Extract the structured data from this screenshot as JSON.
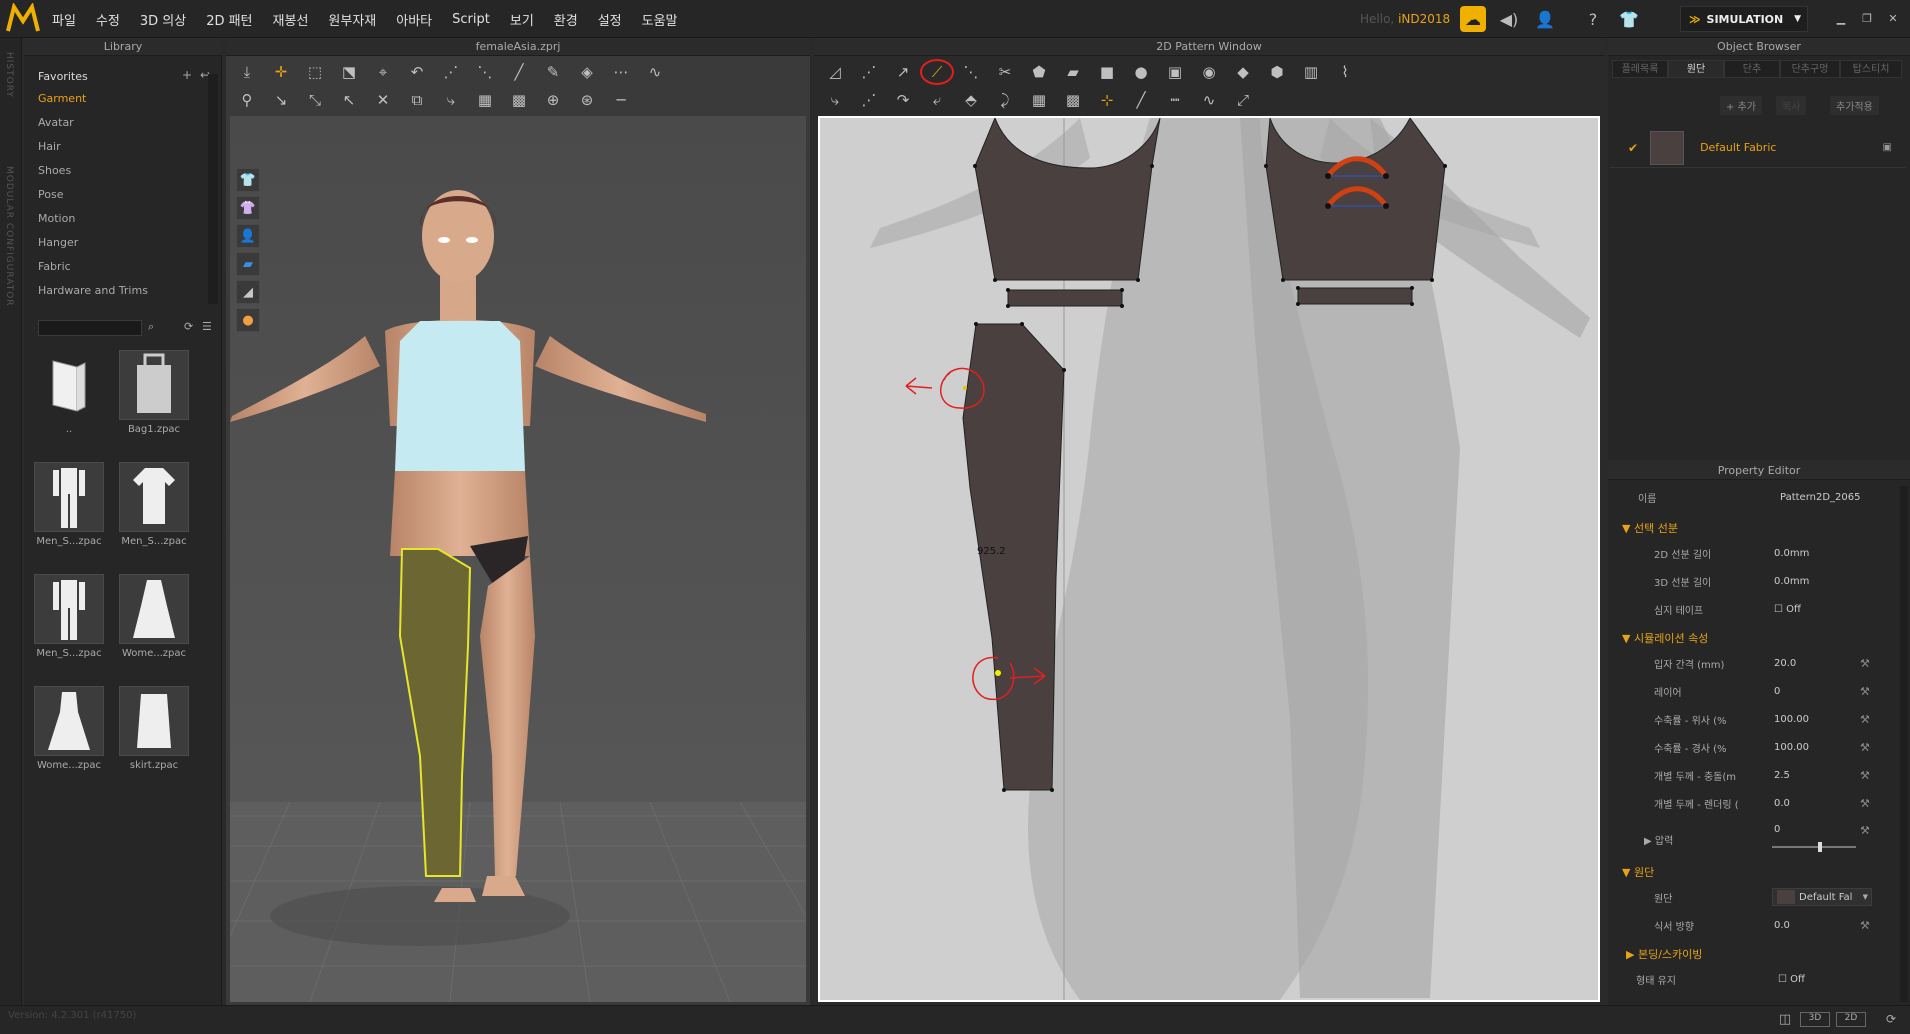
{
  "menu": [
    "파일",
    "수정",
    "3D 의상",
    "2D 패턴",
    "재봉선",
    "원부자재",
    "아바타",
    "Script",
    "보기",
    "환경",
    "설정",
    "도움말"
  ],
  "hello": {
    "prefix": "Hello,",
    "user": "iND2018"
  },
  "simulation": "SIMULATION",
  "side_tabs": {
    "history": "HISTORY",
    "modular": "MODULAR CONFIGURATOR"
  },
  "library": {
    "title": "Library",
    "categories": [
      "Favorites",
      "Garment",
      "Avatar",
      "Hair",
      "Shoes",
      "Pose",
      "Motion",
      "Hanger",
      "Fabric",
      "Hardware and Trims"
    ],
    "thumbs": [
      "..",
      "Bag1.zpac",
      "Men_S...zpac",
      "Men_S...zpac",
      "Men_S...zpac",
      "Wome...zpac",
      "Wome...zpac",
      "skirt.zpac"
    ]
  },
  "view3d": {
    "title": "femaleAsia.zprj"
  },
  "view2d": {
    "title": "2D Pattern Window",
    "measure": "925.2"
  },
  "object_browser": {
    "title": "Object Browser",
    "tabs": [
      "플레목록",
      "원단",
      "단추",
      "단추구멍",
      "탑스티치"
    ],
    "add": "+ 추가",
    "copy": "복사",
    "add_apply": "추가적용",
    "fabric": "Default Fabric"
  },
  "property_editor": {
    "title": "Property Editor",
    "name_label": "이름",
    "name_value": "Pattern2D_2065",
    "sec_select": "선택 선분",
    "len2d_label": "2D 선분 길이",
    "len2d_value": "0.0mm",
    "len3d_label": "3D 선분 길이",
    "len3d_value": "0.0mm",
    "tape_label": "심지 테이프",
    "tape_value": "Off",
    "sec_sim": "시뮬레이션 속성",
    "particle_label": "입자 간격 (mm)",
    "particle_value": "20.0",
    "layer_label": "레이어",
    "layer_value": "0",
    "shrink_w_label": "수축률 - 위사 (%",
    "shrink_w_value": "100.00",
    "shrink_h_label": "수축률 - 경사 (%",
    "shrink_h_value": "100.00",
    "thick_c_label": "개별 두께 - 충돌(m",
    "thick_c_value": "2.5",
    "thick_r_label": "개별 두께 - 렌더링 (",
    "thick_r_value": "0.0",
    "pressure_label": "압력",
    "pressure_value": "0",
    "sec_fabric": "원단",
    "fabric_label": "원단",
    "fabric_value": "Default Fal",
    "grain_label": "식서 방향",
    "grain_value": "0.0",
    "sec_bond": "본딩/스카이빙",
    "keep_label": "형태 유지",
    "keep_value": "Off"
  },
  "status": {
    "version": "Version: 4.2.301 (r41750)",
    "views": [
      "",
      "3D",
      "2D"
    ]
  }
}
